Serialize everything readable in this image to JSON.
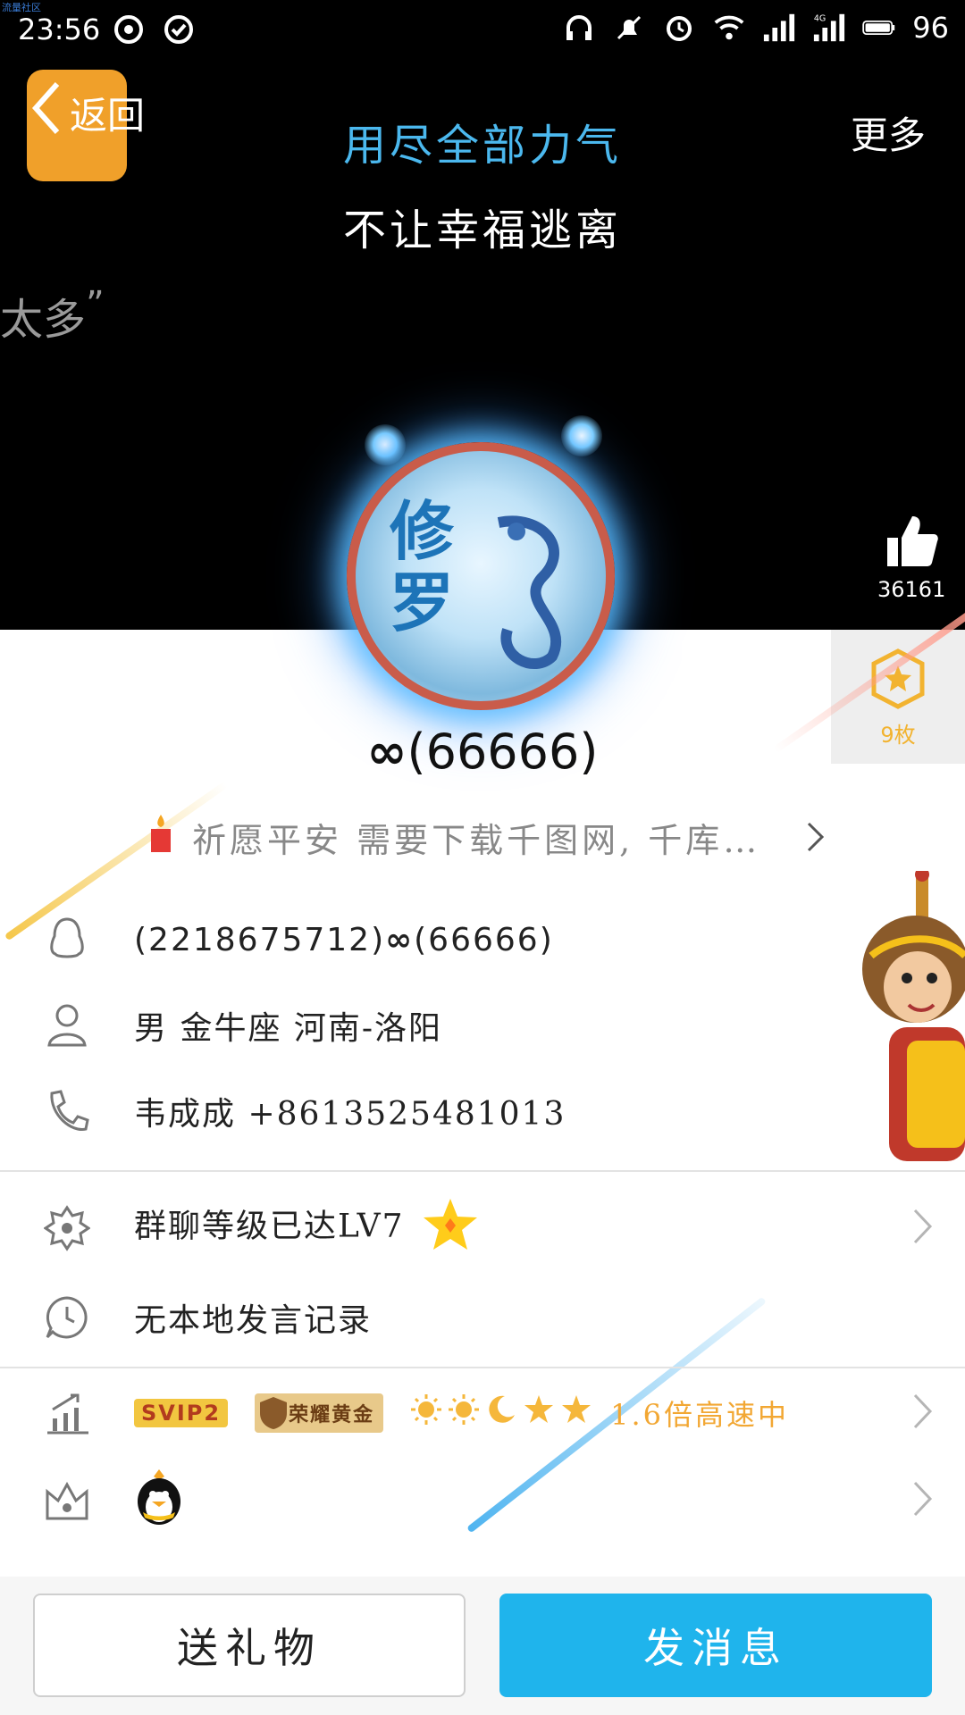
{
  "watermark": "流量社区",
  "status_bar": {
    "time": "23:56",
    "battery": "96",
    "network": "4G"
  },
  "header": {
    "back_label": "返回",
    "more_label": "更多",
    "signature_line1": "用尽全部力气",
    "signature_line2": "不让幸福逃离",
    "side_text": "太多",
    "side_quote_mark": "”"
  },
  "avatar": {
    "text_line1": "修",
    "text_line2": "罗"
  },
  "likes": {
    "count": "36161"
  },
  "medal": {
    "count": "9枚"
  },
  "profile": {
    "nickname": "(66666)",
    "signature": "祈愿平安 需要下载千图网, 千库…",
    "qq_line": "(2218675712)",
    "qq_line_suffix": "(66666)",
    "personal_info": "男  金牛座  河南-洛阳",
    "phone_info": "韦成成 +8613525481013",
    "group_level": "群聊等级已达LV7",
    "local_history": "无本地发言记录"
  },
  "badges": {
    "svip": "SVIP2",
    "honor": "荣耀黄金",
    "speed": "1.6倍高速中"
  },
  "buttons": {
    "gift": "送礼物",
    "message": "发消息"
  },
  "colors": {
    "accent_blue": "#1fb4ec",
    "signature_blue": "#4bb8ee",
    "gold": "#f2a733"
  }
}
